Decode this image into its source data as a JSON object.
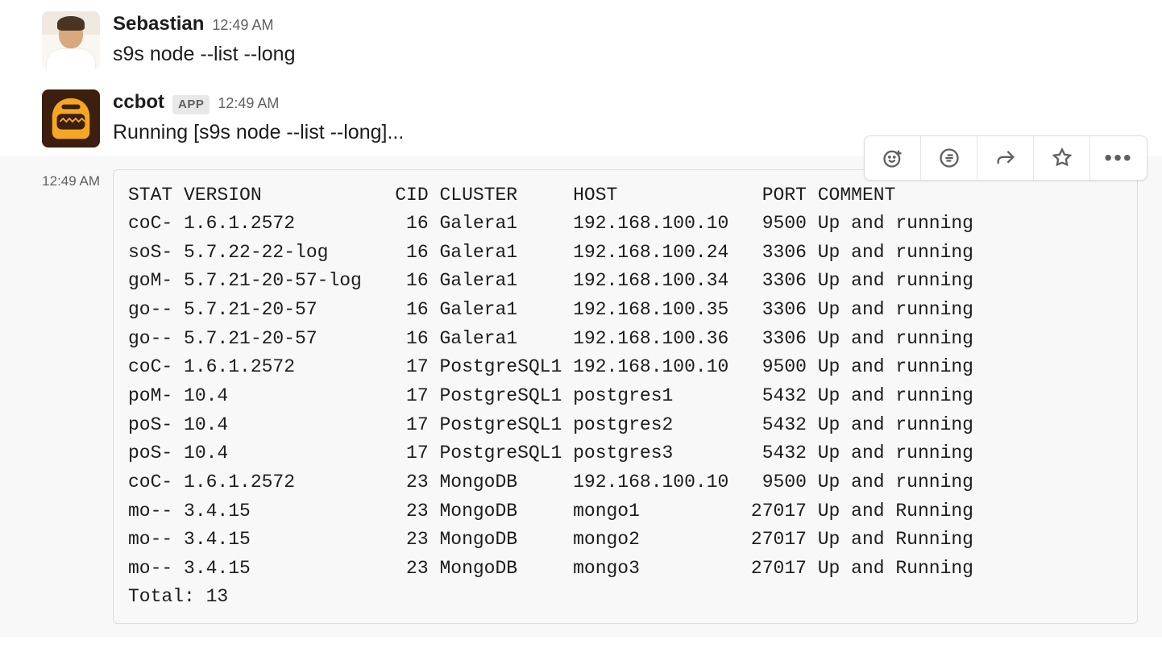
{
  "messages": [
    {
      "author": "Sebastian",
      "timestamp": "12:49 AM",
      "avatar": "sebastian",
      "body": "s9s node --list --long"
    },
    {
      "author": "ccbot",
      "is_app": true,
      "app_badge": "APP",
      "timestamp": "12:49 AM",
      "avatar": "ccbot",
      "body": "Running [s9s node --list --long]..."
    }
  ],
  "followup_timestamp": "12:49 AM",
  "code_output": {
    "columns": [
      "STAT",
      "VERSION",
      "CID",
      "CLUSTER",
      "HOST",
      "PORT",
      "COMMENT"
    ],
    "rows": [
      {
        "stat": "coC-",
        "version": "1.6.1.2572",
        "cid": 16,
        "cluster": "Galera1",
        "host": "192.168.100.10",
        "port": 9500,
        "comment": "Up and running"
      },
      {
        "stat": "soS-",
        "version": "5.7.22-22-log",
        "cid": 16,
        "cluster": "Galera1",
        "host": "192.168.100.24",
        "port": 3306,
        "comment": "Up and running"
      },
      {
        "stat": "goM-",
        "version": "5.7.21-20-57-log",
        "cid": 16,
        "cluster": "Galera1",
        "host": "192.168.100.34",
        "port": 3306,
        "comment": "Up and running"
      },
      {
        "stat": "go--",
        "version": "5.7.21-20-57",
        "cid": 16,
        "cluster": "Galera1",
        "host": "192.168.100.35",
        "port": 3306,
        "comment": "Up and running"
      },
      {
        "stat": "go--",
        "version": "5.7.21-20-57",
        "cid": 16,
        "cluster": "Galera1",
        "host": "192.168.100.36",
        "port": 3306,
        "comment": "Up and running"
      },
      {
        "stat": "coC-",
        "version": "1.6.1.2572",
        "cid": 17,
        "cluster": "PostgreSQL1",
        "host": "192.168.100.10",
        "port": 9500,
        "comment": "Up and running"
      },
      {
        "stat": "poM-",
        "version": "10.4",
        "cid": 17,
        "cluster": "PostgreSQL1",
        "host": "postgres1",
        "port": 5432,
        "comment": "Up and running"
      },
      {
        "stat": "poS-",
        "version": "10.4",
        "cid": 17,
        "cluster": "PostgreSQL1",
        "host": "postgres2",
        "port": 5432,
        "comment": "Up and running"
      },
      {
        "stat": "poS-",
        "version": "10.4",
        "cid": 17,
        "cluster": "PostgreSQL1",
        "host": "postgres3",
        "port": 5432,
        "comment": "Up and running"
      },
      {
        "stat": "coC-",
        "version": "1.6.1.2572",
        "cid": 23,
        "cluster": "MongoDB",
        "host": "192.168.100.10",
        "port": 9500,
        "comment": "Up and running"
      },
      {
        "stat": "mo--",
        "version": "3.4.15",
        "cid": 23,
        "cluster": "MongoDB",
        "host": "mongo1",
        "port": 27017,
        "comment": "Up and Running"
      },
      {
        "stat": "mo--",
        "version": "3.4.15",
        "cid": 23,
        "cluster": "MongoDB",
        "host": "mongo2",
        "port": 27017,
        "comment": "Up and Running"
      },
      {
        "stat": "mo--",
        "version": "3.4.15",
        "cid": 23,
        "cluster": "MongoDB",
        "host": "mongo3",
        "port": 27017,
        "comment": "Up and Running"
      }
    ],
    "total_label": "Total: 13"
  },
  "actions": {
    "react": "add-reaction",
    "thread": "start-thread",
    "share": "share-message",
    "save": "save-message",
    "more": "more-actions"
  }
}
